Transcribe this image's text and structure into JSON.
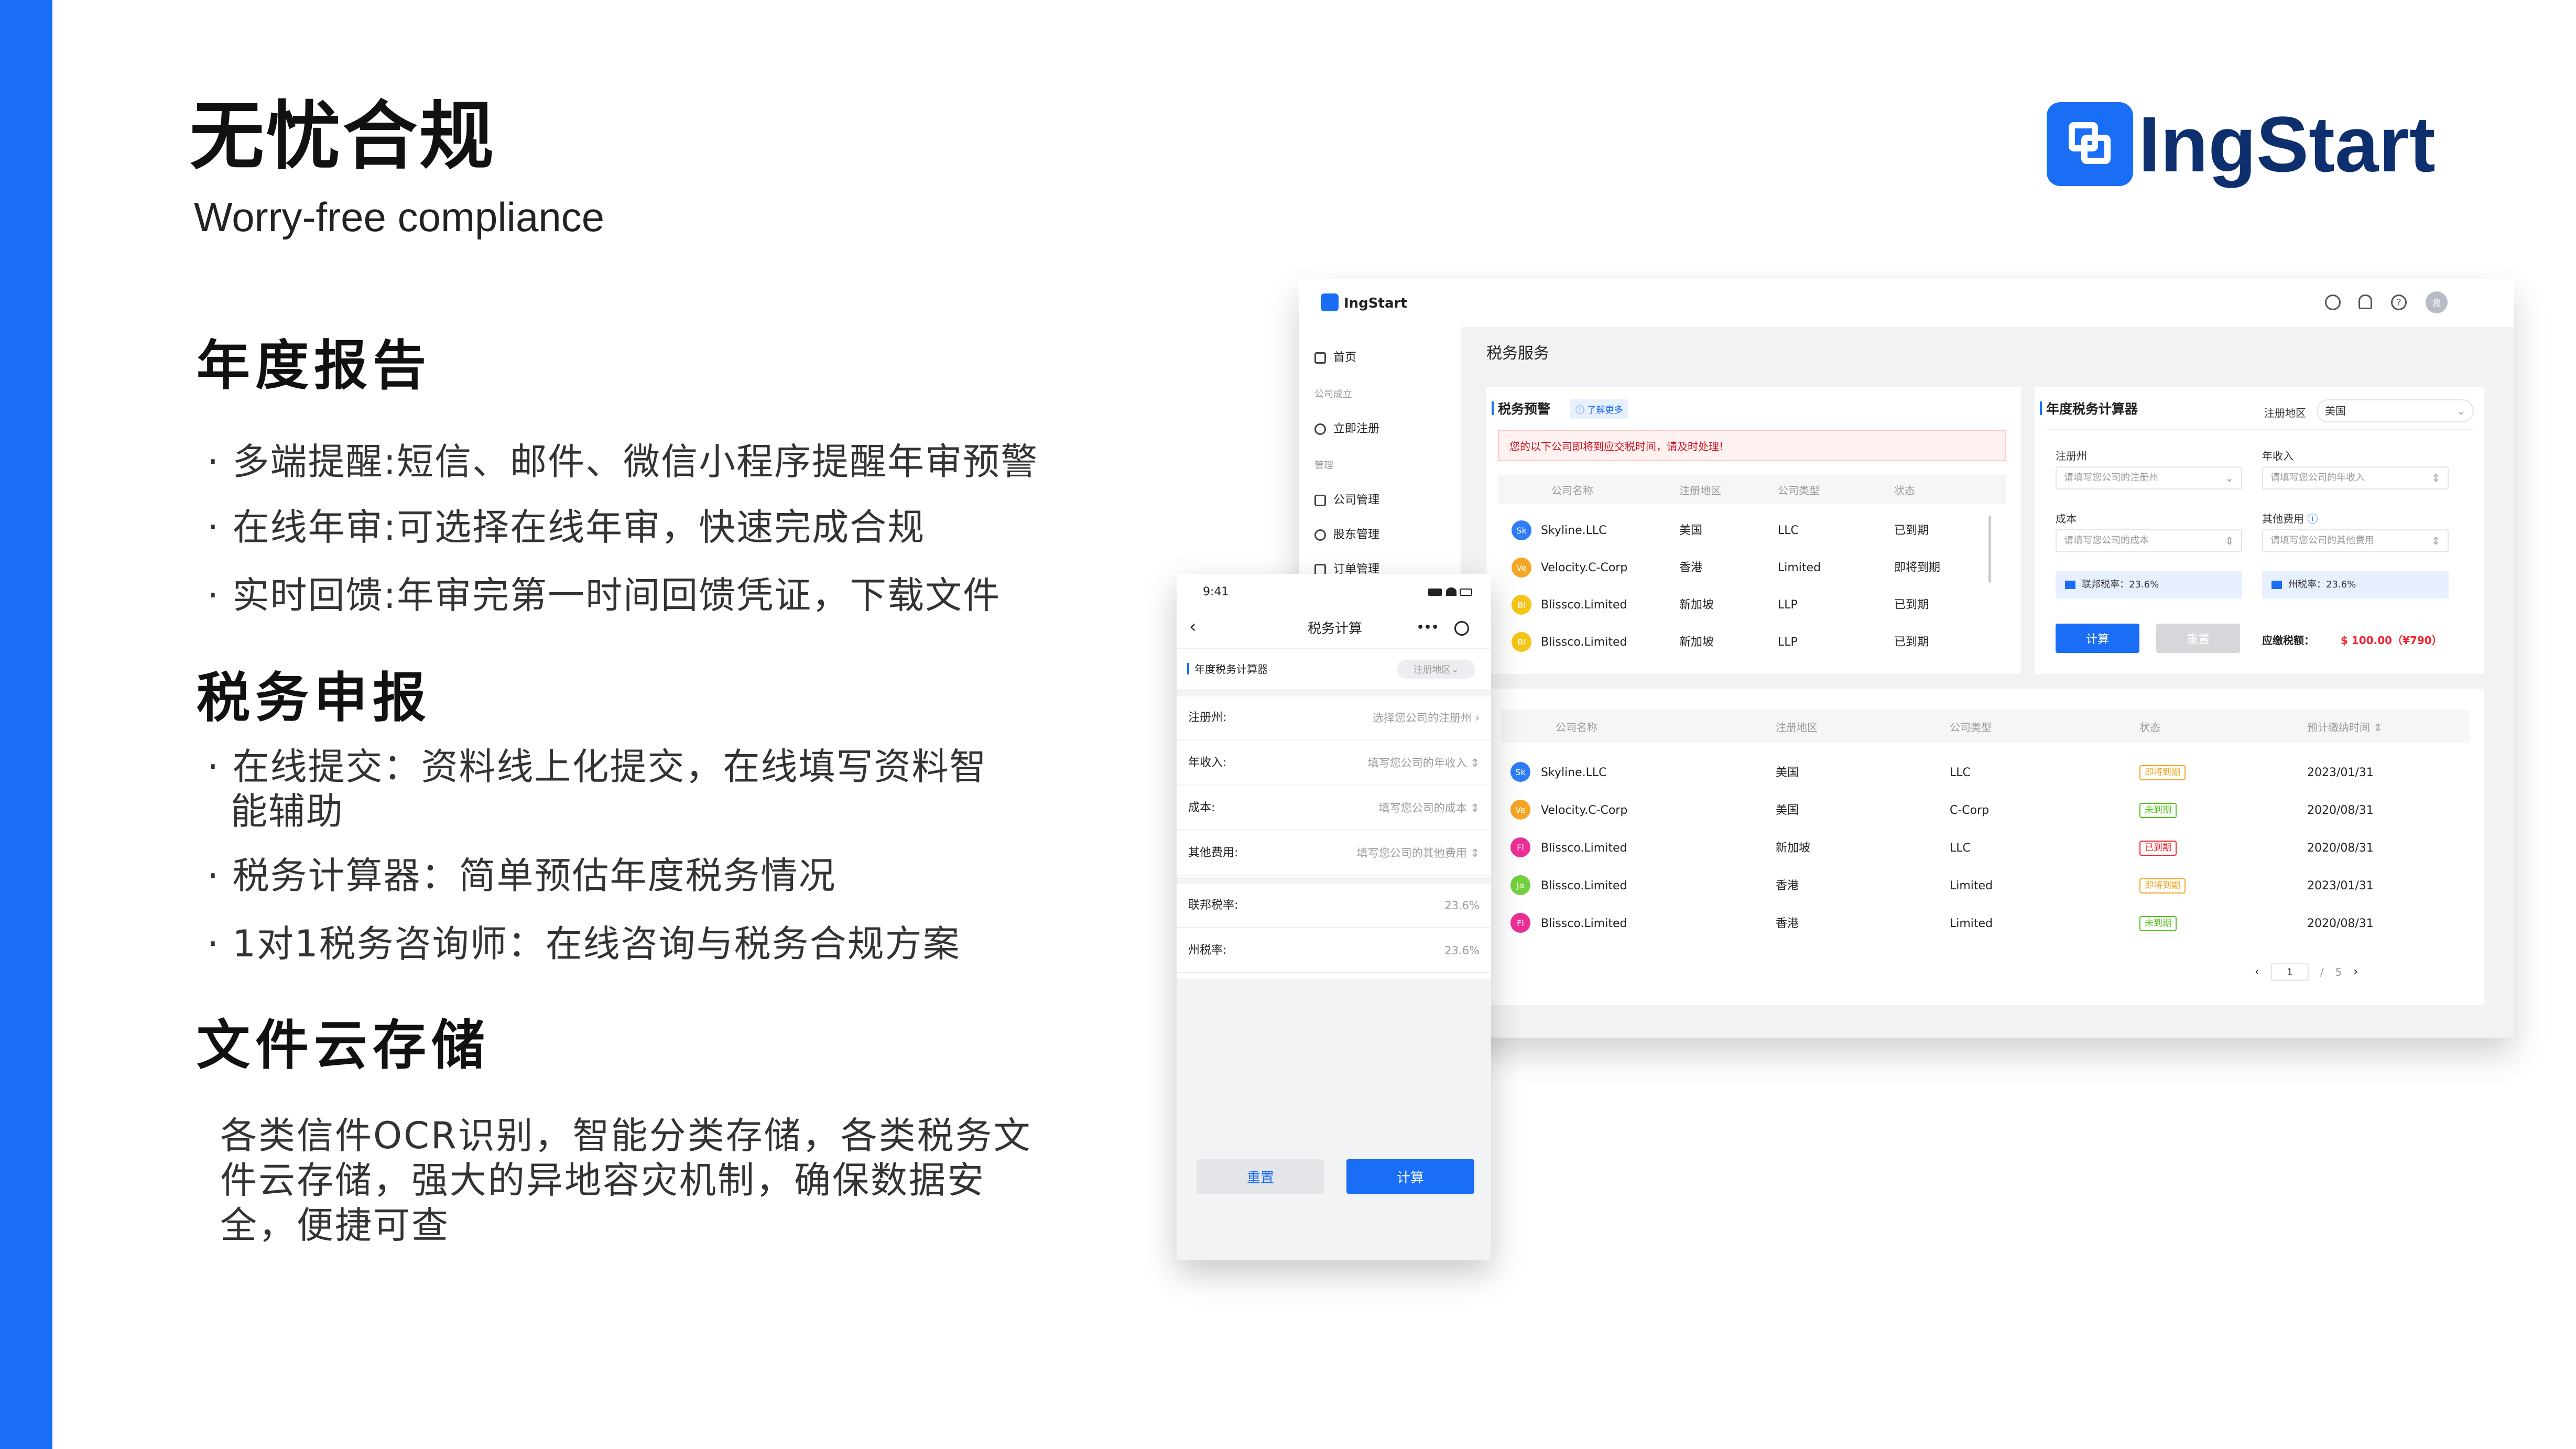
{
  "slide": {
    "title": "无忧合规",
    "subtitle": "Worry-free compliance",
    "brand": "IngStart",
    "accent": "#1a6ef5",
    "sections": [
      {
        "heading": "年度报告",
        "bullets": [
          "· 多端提醒:短信、邮件、微信小程序提醒年审预警",
          "· 在线年审:可选择在线年审，快速完成合规",
          "· 实时回馈:年审完第一时间回馈凭证，下载文件"
        ]
      },
      {
        "heading": "税务申报",
        "bullets": [
          "· 在线提交：资料线上化提交，在线填写资料智",
          "能辅助",
          "· 税务计算器：简单预估年度税务情况",
          "· 1对1税务咨询师：在线咨询与税务合规方案"
        ]
      },
      {
        "heading": "文件云存储",
        "paragraph": [
          "各类信件OCR识别，智能分类存储，各类税务文",
          "件云存储，强大的异地容灾机制，确保数据安",
          "全，便捷可查"
        ]
      }
    ]
  },
  "desktop": {
    "brand": "IngStart",
    "top_avatar": "我",
    "sidebar": [
      {
        "label": "首页",
        "type": "item"
      },
      {
        "label": "公司成立",
        "type": "group"
      },
      {
        "label": "立即注册",
        "type": "item"
      },
      {
        "label": "管理",
        "type": "group"
      },
      {
        "label": "公司管理",
        "type": "item"
      },
      {
        "label": "股东管理",
        "type": "item"
      },
      {
        "label": "订单管理",
        "type": "item"
      }
    ],
    "page_title": "税务服务",
    "warn": {
      "title": "税务预警",
      "link": "了解更多",
      "alert": "您的以下公司即将到应交税时间，请及时处理!",
      "headers": [
        "公司名称",
        "注册地区",
        "公司类型",
        "状态"
      ],
      "rows": [
        {
          "initials": "Sk",
          "color": "#2f7df6",
          "name": "Skyline.LLC",
          "region": "美国",
          "type": "LLC",
          "status": "已到期"
        },
        {
          "initials": "Ve",
          "color": "#f5a623",
          "name": "Velocity.C-Corp",
          "region": "香港",
          "type": "Limited",
          "status": "即将到期"
        },
        {
          "initials": "Bl",
          "color": "#f5c518",
          "name": "Blissco.Limited",
          "region": "新加坡",
          "type": "LLP",
          "status": "已到期"
        },
        {
          "initials": "Bl",
          "color": "#f5c518",
          "name": "Blissco.Limited",
          "region": "新加坡",
          "type": "LLP",
          "status": "已到期"
        }
      ]
    },
    "calc": {
      "title": "年度税务计算器",
      "region_label": "注册地区",
      "region_value": "美国",
      "state_label": "注册州",
      "state_placeholder": "请填写您公司的注册州",
      "income_label": "年收入",
      "income_placeholder": "请填写您公司的年收入",
      "cost_label": "成本",
      "cost_placeholder": "请填写您公司的成本",
      "other_label": "其他费用",
      "other_placeholder": "请填写您公司的其他费用",
      "federal": "联邦税率：23.6%",
      "state_rate": "州税率：23.6%",
      "calc_btn": "计算",
      "reset_btn": "重置",
      "due_label": "应缴税额：",
      "due_value": "$ 100.00（¥790）"
    },
    "list": {
      "headers": [
        "公司名称",
        "注册地区",
        "公司类型",
        "状态",
        "预计缴纳时间"
      ],
      "rows": [
        {
          "initials": "Sk",
          "color": "#2f7df6",
          "name": "Skyline.LLC",
          "region": "美国",
          "type": "LLC",
          "status": "即将到期",
          "status_color": "#f5a623",
          "date": "2023/01/31"
        },
        {
          "initials": "Ve",
          "color": "#f5a623",
          "name": "Velocity.C-Corp",
          "region": "美国",
          "type": "C-Corp",
          "status": "未到期",
          "status_color": "#52c41a",
          "date": "2020/08/31"
        },
        {
          "initials": "Fl",
          "color": "#eb2f96",
          "name": "Blissco.Limited",
          "region": "新加坡",
          "type": "LLC",
          "status": "已到期",
          "status_color": "#f5222d",
          "date": "2020/08/31"
        },
        {
          "initials": "Ja",
          "color": "#73d13d",
          "name": "Blissco.Limited",
          "region": "香港",
          "type": "Limited",
          "status": "即将到期",
          "status_color": "#f5a623",
          "date": "2023/01/31"
        },
        {
          "initials": "Fl",
          "color": "#eb2f96",
          "name": "Blissco.Limited",
          "region": "香港",
          "type": "Limited",
          "status": "未到期",
          "status_color": "#52c41a",
          "date": "2020/08/31"
        }
      ],
      "page_current": "1",
      "page_sep": "/",
      "page_total": "5"
    }
  },
  "mobile": {
    "time": "9:41",
    "title": "税务计算",
    "section": "年度税务计算器",
    "region_pill": "注册地区",
    "rows": [
      {
        "label": "注册州:",
        "value": "选择您公司的注册州"
      },
      {
        "label": "年收入:",
        "value": "填写您公司的年收入"
      },
      {
        "label": "成本:",
        "value": "填写您公司的成本"
      },
      {
        "label": "其他费用:",
        "value": "填写您公司的其他费用"
      }
    ],
    "rates": [
      {
        "label": "联邦税率:",
        "value": "23.6%"
      },
      {
        "label": "州税率:",
        "value": "23.6%"
      }
    ],
    "reset_btn": "重置",
    "calc_btn": "计算"
  }
}
